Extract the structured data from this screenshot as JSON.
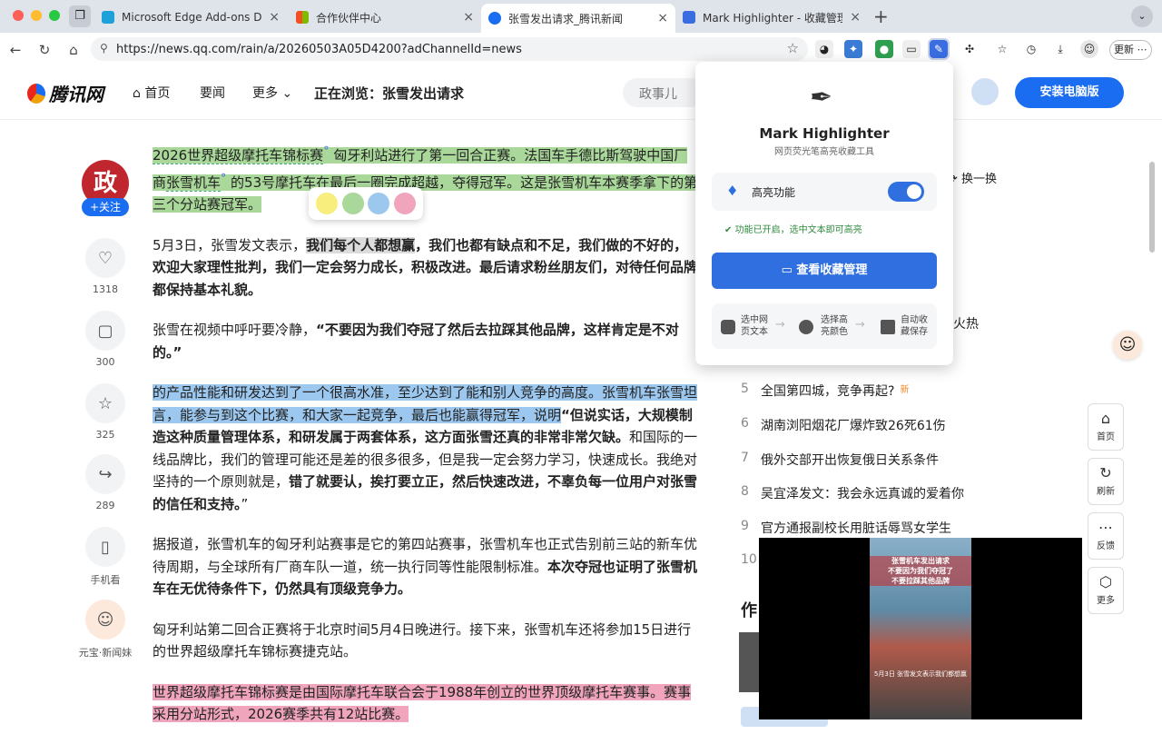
{
  "browser": {
    "tabs": [
      {
        "label": "Microsoft Edge Add-ons Develo",
        "close": "×",
        "color": "#1ea0d8"
      },
      {
        "label": "合作伙伴中心",
        "close": "×",
        "color": "#f25022"
      },
      {
        "label": "张雪发出请求_腾讯新闻",
        "close": "×",
        "color": "#1a6cf0"
      },
      {
        "label": "Mark Highlighter - 收藏管理",
        "close": "×",
        "color": "#3a6de0"
      }
    ],
    "new_tab": "+",
    "url": "https://news.qq.com/rain/a/20260503A05D4200?adChannelId=news",
    "update_label": "更新"
  },
  "site": {
    "logo": "腾讯网",
    "nav_home": "首页",
    "nav_news": "要闻",
    "nav_more": "更多",
    "now_reading": "正在浏览：张雪发出请求",
    "search_text": "政事儿",
    "install_btn": "安装电脑版"
  },
  "author": {
    "follow": "+关注"
  },
  "actions": [
    {
      "count": "1318"
    },
    {
      "count": "300"
    },
    {
      "count": "325"
    },
    {
      "count": "289"
    },
    {
      "label": "手机看"
    },
    {
      "label": "元宝·新闻妹"
    }
  ],
  "article": {
    "p1_a": "2026世界超级摩托车锦标赛",
    "p1_b": " 匈牙利站进行了第一回合正赛。法国车手德比斯驾驶中国厂商",
    "p1_c": "张雪机车",
    "p1_d": " 的53号摩托车在最后一圈完成超越，夺得冠军。这是张雪机车本赛季拿下的第三个分站赛冠军。",
    "p2_a": "5月3日，张雪发文表示，",
    "p2_b": "我们每个人都想赢",
    "p2_c": "，我们也都有缺点和不足，我们做的不好的，欢迎大家理性批判，我们一定会努力成长，积极改进。最后请求粉丝朋友们，对待任何品牌都保持基本礼貌。",
    "p3_a": "张雪在视频中呼吁要冷静，",
    "p3_b": "“不要因为我们夺冠了然后去拉踩其他品牌，这样肯定是不对的。”",
    "p4_a": "的产品性能和研发达到了一个很高水准，至少达到了能和别人竞争的高度。张雪机车张雪坦言，能参与到这个比赛，和大家一起竞争，最后也能赢得冠军，说明",
    "p4_b": "“但说实话，大规模制造这种质量管理体系，和研发属于两套体系，这方面张雪还真的非常非常欠缺。",
    "p4_c": "和国际的一线品牌比，我们的管理可能还是差的很多很多，但是我一定会努力学习，快速成长。我绝对坚持的一个原则就是，",
    "p4_d": "错了就要认，挨打要立正，然后快速改进，不辜负每一位用户对张雪的信任和支持。",
    "p4_e": "”",
    "p5_a": "据报道，张雪机车的匈牙利站赛事是它的第四站赛事，张雪机车也正式告别前三站的新车优待周期，与全球所有厂商车队一道，统一执行同等性能限制标准。",
    "p5_b": "本次夺冠也证明了张雪机车在无优待条件下，仍然具有顶级竞争力。",
    "p6": "匈牙利站第二回合正赛将于北京时间5月4日晚进行。接下来，张雪机车还将参加15日进行的世界超级摩托车锦标赛捷克站。",
    "p7": "世界超级摩托车锦标赛是由国际摩托车联合会于1988年创立的世界顶级摩托车赛事。赛事采用分站形式，2026赛季共有12站比赛。"
  },
  "palette": [
    "#f7ee7d",
    "#a9d89a",
    "#9cc8f0",
    "#f0a5bd"
  ],
  "sidebar": {
    "refresh": "换一换",
    "hot_suffix": "火热",
    "ranks": [
      {
        "n": "5",
        "t": "全国第四城，竞争再起?",
        "badge": "新"
      },
      {
        "n": "6",
        "t": "湖南浏阳烟花厂爆炸致26死61伤"
      },
      {
        "n": "7",
        "t": "俄外交部开出恢复俄日关系条件"
      },
      {
        "n": "8",
        "t": "吴宜泽发文：我会永远真诚的爱着你"
      },
      {
        "n": "9",
        "t": "官方通报副校长用脏话辱骂女学生"
      },
      {
        "n": "10",
        "t": ""
      }
    ],
    "author_head": "作"
  },
  "float_btns": [
    "首页",
    "刷新",
    "反馈",
    "更多"
  ],
  "video": {
    "caption1": "张雪机车发出请求",
    "caption2": "不要因为我们夺冠了",
    "caption3": "不要拉踩其他品牌",
    "sub": "5月3日 张雪发文表示我们都想赢"
  },
  "popup": {
    "title": "Mark Highlighter",
    "subtitle": "网页荧光笔高亮收藏工具",
    "feature_label": "高亮功能",
    "status": "功能已开启，选中文本即可高亮",
    "manage_btn": "查看收藏管理",
    "steps": [
      {
        "l1": "选中网",
        "l2": "页文本"
      },
      {
        "l1": "选择高",
        "l2": "亮颜色"
      },
      {
        "l1": "自动收",
        "l2": "藏保存"
      }
    ]
  }
}
